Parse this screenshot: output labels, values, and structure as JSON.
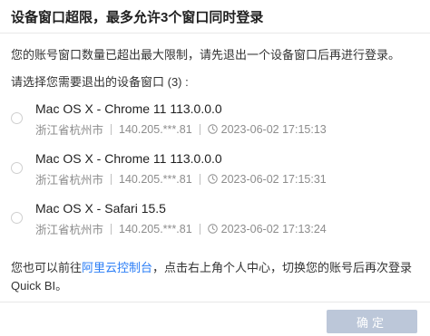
{
  "dialog": {
    "title": "设备窗口超限，最多允许3个窗口同时登录",
    "intro": "您的账号窗口数量已超出最大限制，请先退出一个设备窗口后再进行登录。",
    "select_prompt": "请选择您需要退出的设备窗口 (3) :"
  },
  "devices": [
    {
      "name": "Mac OS X - Chrome 11 113.0.0.0",
      "location": "浙江省杭州市",
      "ip": "140.205.***.81",
      "time": "2023-06-02 17:15:13",
      "selected": false
    },
    {
      "name": "Mac OS X - Chrome 11 113.0.0.0",
      "location": "浙江省杭州市",
      "ip": "140.205.***.81",
      "time": "2023-06-02 17:15:31",
      "selected": false
    },
    {
      "name": "Mac OS X - Safari 15.5",
      "location": "浙江省杭州市",
      "ip": "140.205.***.81",
      "time": "2023-06-02 17:13:24",
      "selected": false
    }
  ],
  "footer_note": {
    "before_link": "您也可以前往",
    "link_text": "阿里云控制台",
    "after_link": "，点击右上角个人中心，切换您的账号后再次登录 Quick BI。"
  },
  "confirm_button": {
    "label": "确定",
    "disabled": true
  },
  "colors": {
    "link": "#2a7df6",
    "button_disabled_bg": "#bcc7d9",
    "muted_text": "#8c8c8c"
  },
  "icons": {
    "radio": "radio-unchecked-icon",
    "time": "clock-icon"
  }
}
